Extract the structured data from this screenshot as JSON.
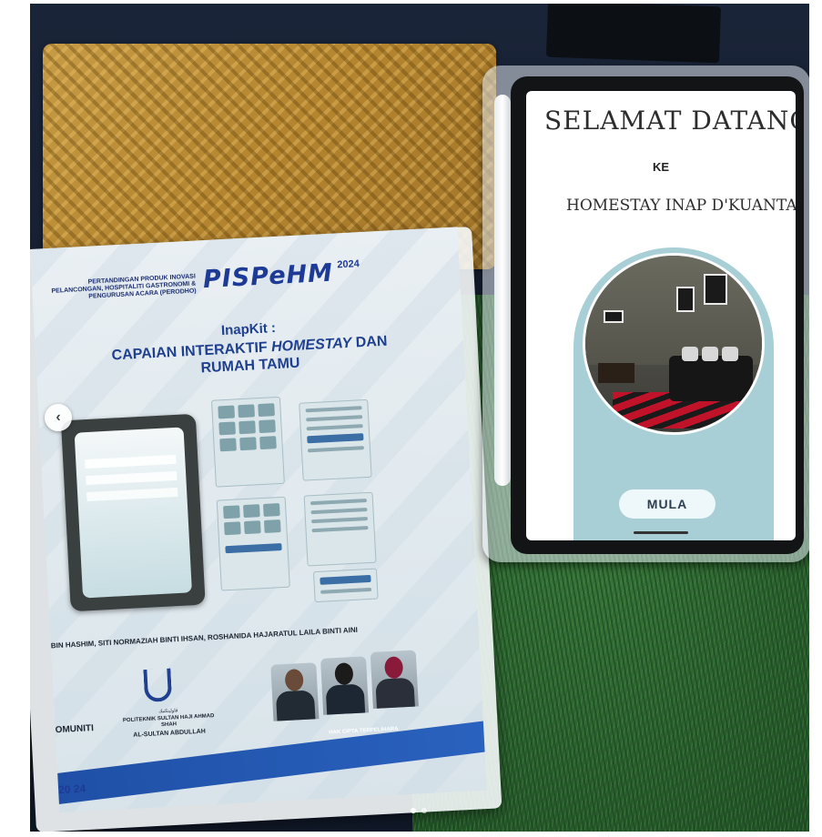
{
  "poster": {
    "competition": "PERTANDINGAN PRODUK INOVASI PELANCONGAN, HOSPITALITI GASTRONOMI & PENGURUSAN ACARA (PERODHO)",
    "logo_text": "PISPeHM",
    "logo_year": "2024",
    "subtitle": "",
    "kit_name": "InapKit :",
    "title_line1_part1": "CAPAIAN INTERAKTIF ",
    "title_line1_italic": "HOMESTAY",
    "title_line1_part2": " DAN",
    "title_line2": "RUMAH TAMU",
    "authors": "BIN HASHIM, SITI NORMAZIAH BINTI IHSAN, ROSHANIDA HAJARATUL LAILA BINTI AINI",
    "university": "POLITEKNIK SULTAN HAJI AHMAD SHAH",
    "university_sub": "AL-SULTAN ABDULLAH",
    "komuniti": "OMUNITI",
    "copyright": "HAK CIPTA TERPELIHARA",
    "corner": "20 24"
  },
  "tablet": {
    "time": "",
    "url": "",
    "welcome": "SELAMAT DATANG",
    "ke": "KE",
    "homestay": "HOMESTAY INAP D'KUANTAN",
    "tiny_text": "",
    "button_label": "MULA"
  },
  "carousel": {
    "prev_icon": "chevron-left-icon",
    "total_slides": 2,
    "active_slide": 1
  }
}
